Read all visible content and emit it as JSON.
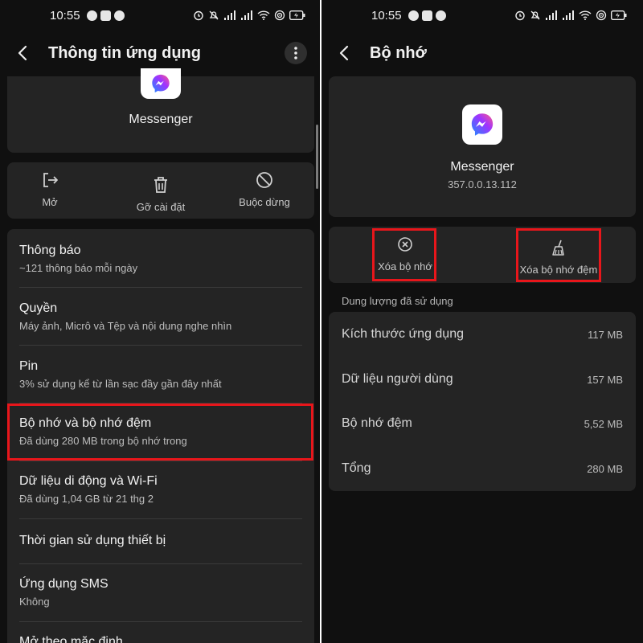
{
  "status_bar": {
    "time": "10:55"
  },
  "left": {
    "appbar": {
      "title": "Thông tin ứng dụng"
    },
    "app": {
      "name": "Messenger"
    },
    "actions": [
      {
        "label": "Mở",
        "icon": "open-icon"
      },
      {
        "label": "Gỡ cài đặt",
        "icon": "trash-icon"
      },
      {
        "label": "Buộc dừng",
        "icon": "block-icon"
      }
    ],
    "list": [
      {
        "title": "Thông báo",
        "subtitle": "~121 thông báo mỗi ngày"
      },
      {
        "title": "Quyền",
        "subtitle": "Máy ảnh, Micrô và Tệp và nội dung nghe nhìn"
      },
      {
        "title": "Pin",
        "subtitle": "3% sử dụng kể từ lần sạc đầy gần đây nhất"
      },
      {
        "title": "Bộ nhớ và bộ nhớ đệm",
        "subtitle": "Đã dùng 280 MB trong bộ nhớ trong"
      },
      {
        "title": "Dữ liệu di động và Wi-Fi",
        "subtitle": "Đã dùng 1,04 GB từ 21 thg 2"
      },
      {
        "title": "Thời gian sử dụng thiết bị",
        "subtitle": ""
      },
      {
        "title": "Ứng dụng SMS",
        "subtitle": "Không"
      },
      {
        "title": "Mở theo mặc định",
        "subtitle": ""
      }
    ]
  },
  "right": {
    "appbar": {
      "title": "Bộ nhớ"
    },
    "app": {
      "name": "Messenger",
      "version": "357.0.0.13.112"
    },
    "actions": [
      {
        "label": "Xóa bộ nhớ",
        "icon": "clear-circle-icon"
      },
      {
        "label": "Xóa bộ nhớ đệm",
        "icon": "broom-icon"
      }
    ],
    "section_label": "Dung lượng đã sử dụng",
    "storage": [
      {
        "label": "Kích thước ứng dụng",
        "value": "117 MB"
      },
      {
        "label": "Dữ liệu người dùng",
        "value": "157 MB"
      },
      {
        "label": "Bộ nhớ đệm",
        "value": "5,52 MB"
      },
      {
        "label": "Tổng",
        "value": "280 MB"
      }
    ]
  },
  "colors": {
    "background": "#101010",
    "card": "#242424",
    "highlight": "#e8161b",
    "messenger_gradient": [
      "#1c8cff",
      "#a033ff",
      "#ff5c87"
    ]
  }
}
